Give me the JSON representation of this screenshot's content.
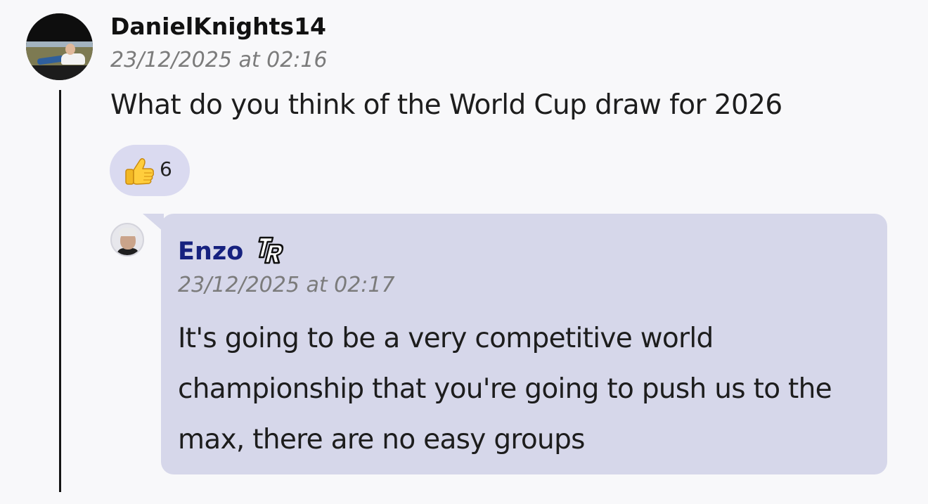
{
  "post": {
    "author": "DanielKnights14",
    "timestamp": "23/12/2025 at 02:16",
    "text": "What do you think of the World Cup draw for 2026",
    "reaction": {
      "icon": "thumbs-up-icon",
      "count": "6"
    }
  },
  "reply": {
    "author": "Enzo",
    "badge_icon": "tr-badge-icon",
    "timestamp": "23/12/2025 at 02:17",
    "text": "It's going to be a very competitive world championship that you're going to push us to the max, there are no easy groups"
  },
  "colors": {
    "background": "#f8f8fa",
    "bubble": "#d6d7ea",
    "reaction_pill": "#dadaf0",
    "reply_author": "#16217f",
    "timestamp": "#7b7b7b",
    "thread_line": "#141414"
  }
}
